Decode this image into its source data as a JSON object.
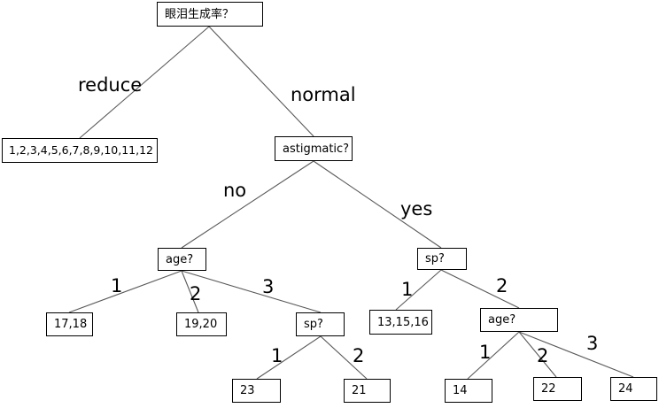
{
  "nodes": {
    "root": "眼泪生成率？",
    "reduce_leaf": "1,2,3,4,5,6,7,8,9,10,11,12",
    "astigmatic": "astigmatic?",
    "age_no": "age?",
    "sp_yes": "sp?",
    "leaf_17_18": "17,18",
    "leaf_19_20": "19,20",
    "sp_age3": "sp?",
    "leaf_13_15_16": "13,15,16",
    "age_sp2": "age?",
    "leaf_23": "23",
    "leaf_21": "21",
    "leaf_14": "14",
    "leaf_22": "22",
    "leaf_24": "24"
  },
  "edges": {
    "reduce": "reduce",
    "normal": "normal",
    "no": "no",
    "yes": "yes",
    "age_1": "1",
    "age_2": "2",
    "age_3": "3",
    "sp_1": "1",
    "sp_2": "2",
    "sp3_1": "1",
    "sp3_2": "2",
    "age2_1": "1",
    "age2_2": "2",
    "age2_3": "3"
  }
}
